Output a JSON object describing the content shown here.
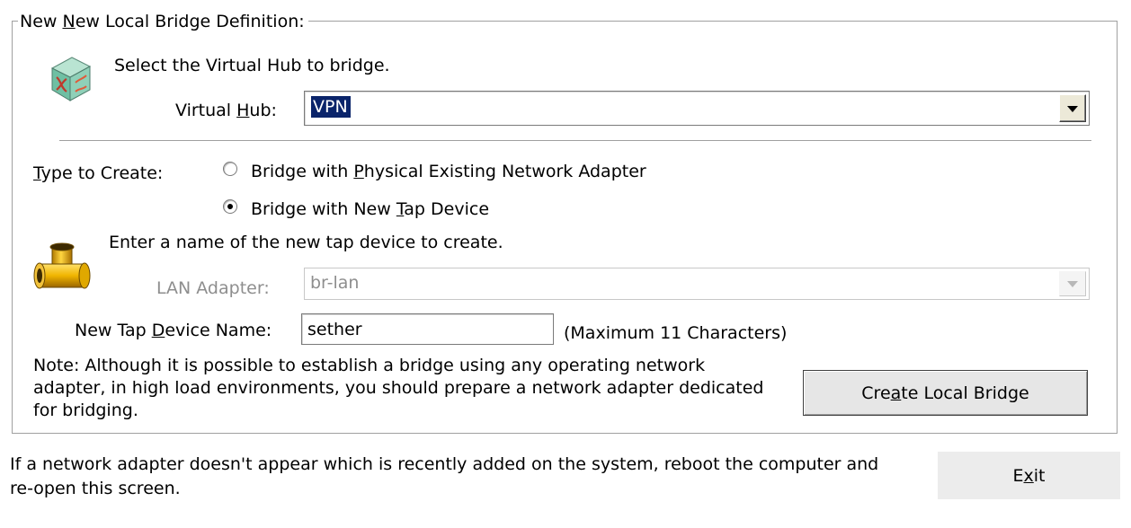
{
  "group": {
    "title_pre": "New ",
    "title_mnemonic": "N",
    "title_post": "ew Local Bridge Definition:"
  },
  "hub_section": {
    "icon": "virtual-hub-icon",
    "instruction": "Select the Virtual Hub to bridge.",
    "label_pre": "Virtual ",
    "label_mnemonic": "H",
    "label_post": "ub:",
    "value": "VPN"
  },
  "type_section": {
    "label_mnemonic": "T",
    "label_post": "ype to Create:",
    "options": [
      {
        "pre": "Bridge with ",
        "mnemonic": "P",
        "post": "hysical Existing Network Adapter",
        "checked": false
      },
      {
        "pre": "Bridge with New ",
        "mnemonic": "T",
        "post": "ap Device",
        "checked": true
      }
    ]
  },
  "tap_section": {
    "icon": "tap-pipe-icon",
    "instruction": "Enter a name of the new tap device to create.",
    "lan_label": "LAN Adapter:",
    "lan_value": "br-lan",
    "name_label_pre": "New Tap ",
    "name_label_mnemonic": "D",
    "name_label_post": "evice Name:",
    "name_value": "sether",
    "name_hint": "(Maximum 11 Characters)"
  },
  "note": {
    "line1": "Note: Although it is possible to establish a bridge using any operating network",
    "line2": "adapter, in high load environments, you should prepare a network adapter dedicated",
    "line3": "for bridging."
  },
  "create_button": {
    "pre": "Cre",
    "mnemonic": "a",
    "post": "te Local Bridge"
  },
  "footer": {
    "line1": "If a network adapter doesn't appear which is recently added on the system, reboot the computer and",
    "line2": "re-open this screen.",
    "exit_pre": "E",
    "exit_mnemonic": "x",
    "exit_post": "it"
  },
  "colors": {
    "selection": "#0a246a",
    "border": "#a0a0a0",
    "disabled_text": "#8e8e8e"
  }
}
